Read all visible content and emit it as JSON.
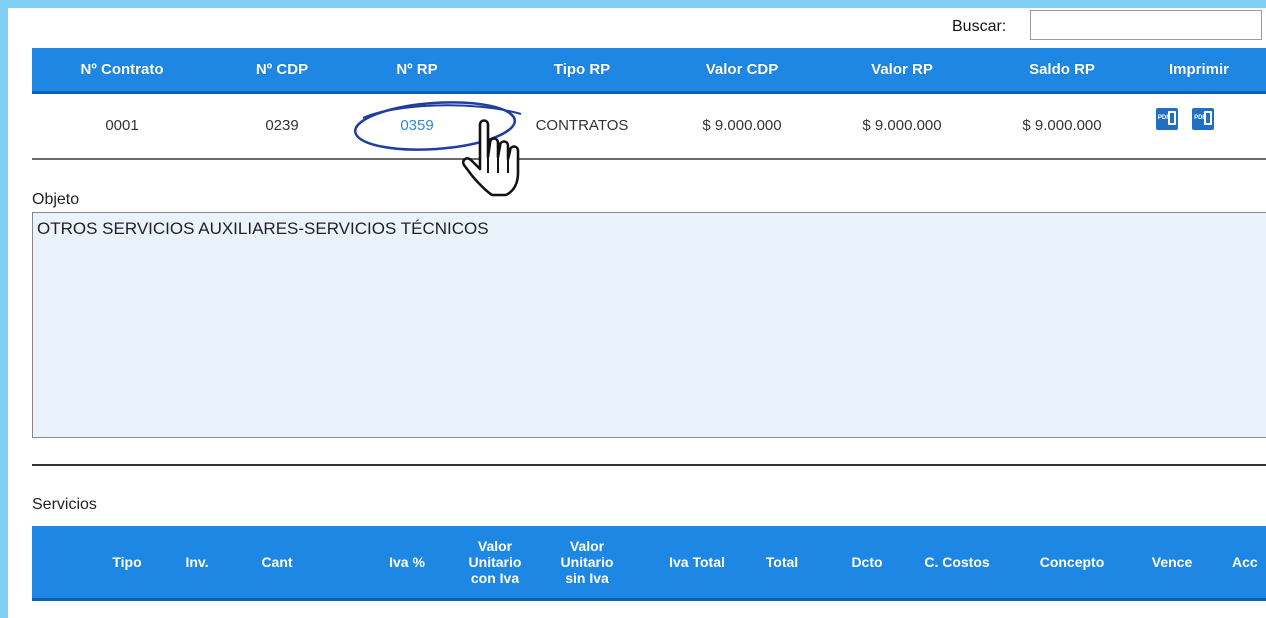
{
  "search": {
    "label": "Buscar:",
    "value": ""
  },
  "rp_table": {
    "headers": [
      "Nº Contrato",
      "Nº CDP",
      "Nº RP",
      "Tipo RP",
      "Valor CDP",
      "Valor RP",
      "Saldo RP",
      "Imprimir"
    ],
    "row": {
      "contrato": "0001",
      "cdp": "0239",
      "rp": "0359",
      "tipo": "CONTRATOS",
      "valor_cdp": "$ 9.000.000",
      "valor_rp": "$ 9.000.000",
      "saldo_rp": "$ 9.000.000",
      "pdf_label": "PDF"
    }
  },
  "objeto": {
    "label": "Objeto",
    "text": "OTROS SERVICIOS AUXILIARES-SERVICIOS TÉCNICOS"
  },
  "servicios": {
    "label": "Servicios",
    "headers": [
      "Tipo",
      "Inv.",
      "Cant",
      "Iva %",
      "Valor Unitario con Iva",
      "Valor Unitario sin Iva",
      "Iva Total",
      "Total",
      "Dcto",
      "C. Costos",
      "Concepto",
      "Vence",
      "Acc"
    ]
  },
  "colors": {
    "header_blue": "#1e87e4",
    "frame": "#7fd0f4",
    "link": "#2a8bd8",
    "annotation": "#1f3f9e"
  },
  "icons": [
    "pdf-icon",
    "pointer-hand-cursor"
  ]
}
